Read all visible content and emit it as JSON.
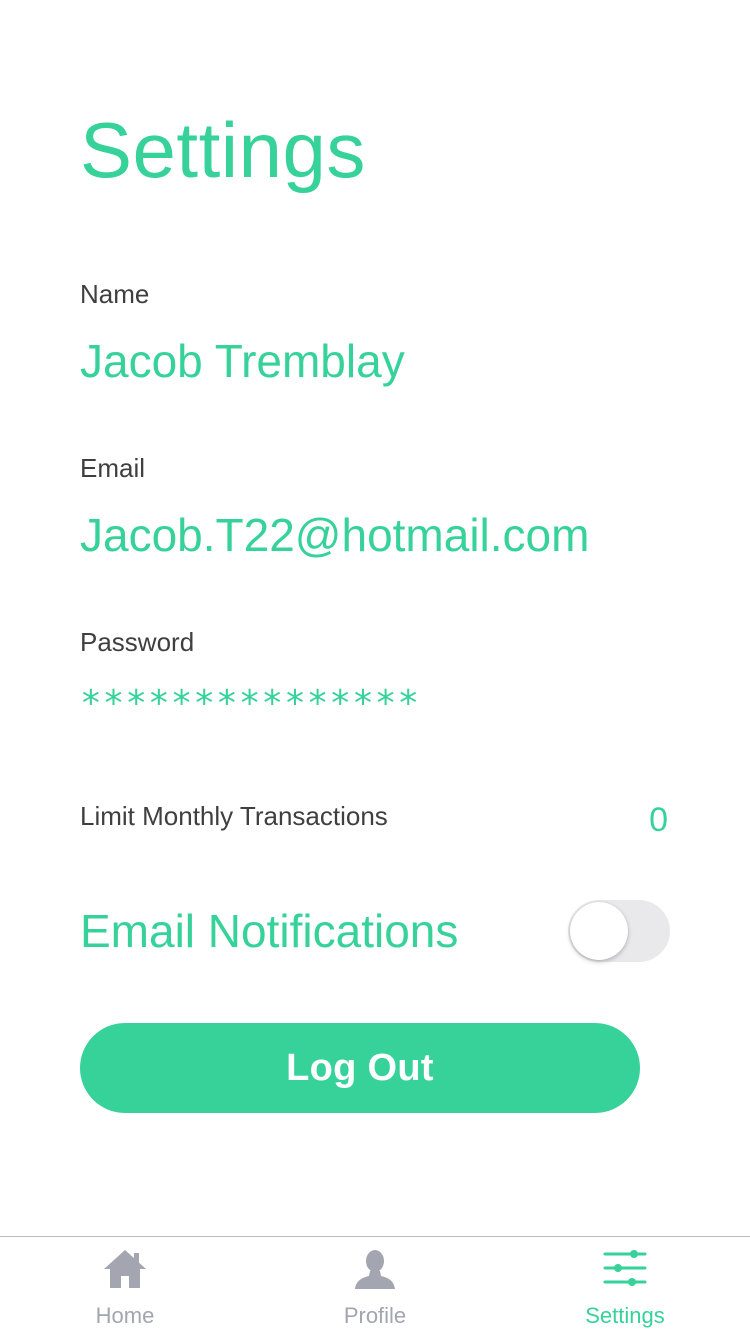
{
  "title": "Settings",
  "fields": {
    "name": {
      "label": "Name",
      "value": "Jacob Tremblay"
    },
    "email": {
      "label": "Email",
      "value": "Jacob.T22@hotmail.com"
    },
    "password": {
      "label": "Password",
      "value": "***************"
    }
  },
  "limit_monthly": {
    "label": "Limit Monthly Transactions",
    "value": "0"
  },
  "email_notifications": {
    "label": "Email Notifications",
    "enabled": false
  },
  "logout_label": "Log Out",
  "tabs": [
    {
      "label": "Home",
      "icon": "home-icon",
      "active": false
    },
    {
      "label": "Profile",
      "icon": "profile-icon",
      "active": false
    },
    {
      "label": "Settings",
      "icon": "sliders-icon",
      "active": true
    }
  ],
  "colors": {
    "accent": "#36d29a",
    "label_text": "#3f3f3f",
    "inactive_tab": "#a3a5b0",
    "toggle_off": "#e9e9eb"
  }
}
